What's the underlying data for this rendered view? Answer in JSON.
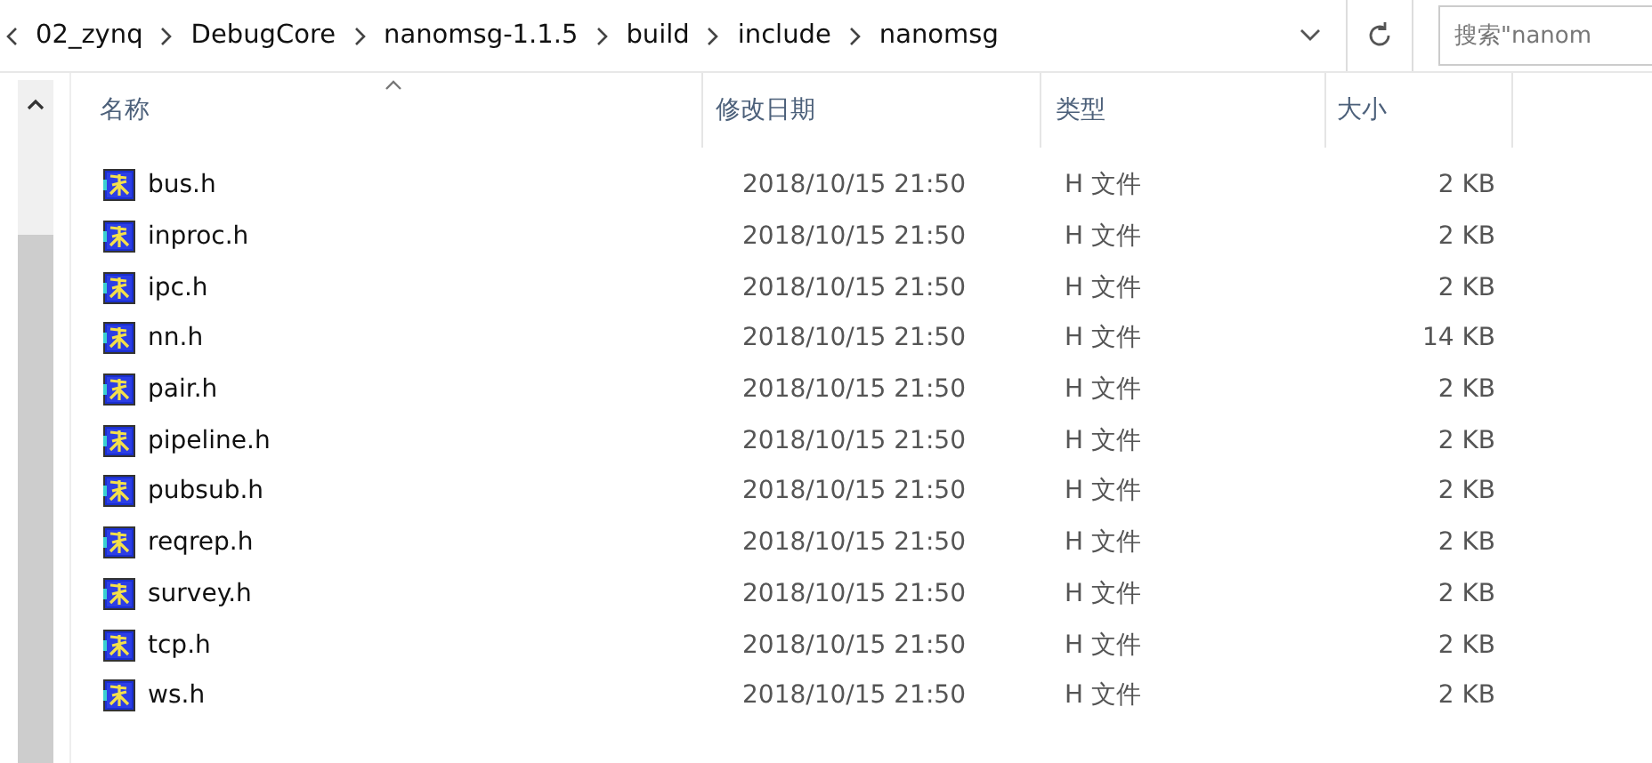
{
  "address_bar": {
    "path": [
      "02_zynq",
      "DebugCore",
      "nanomsg-1.1.5",
      "build",
      "include",
      "nanomsg"
    ]
  },
  "search": {
    "placeholder": "搜索\"nanom"
  },
  "table": {
    "columns": [
      "名称",
      "修改日期",
      "类型",
      "大小"
    ],
    "rows": [
      {
        "name": "bus.h",
        "modified": "2018/10/15 21:50",
        "type": "H 文件",
        "size": "2 KB"
      },
      {
        "name": "inproc.h",
        "modified": "2018/10/15 21:50",
        "type": "H 文件",
        "size": "2 KB"
      },
      {
        "name": "ipc.h",
        "modified": "2018/10/15 21:50",
        "type": "H 文件",
        "size": "2 KB"
      },
      {
        "name": "nn.h",
        "modified": "2018/10/15 21:50",
        "type": "H 文件",
        "size": "14 KB"
      },
      {
        "name": "pair.h",
        "modified": "2018/10/15 21:50",
        "type": "H 文件",
        "size": "2 KB"
      },
      {
        "name": "pipeline.h",
        "modified": "2018/10/15 21:50",
        "type": "H 文件",
        "size": "2 KB"
      },
      {
        "name": "pubsub.h",
        "modified": "2018/10/15 21:50",
        "type": "H 文件",
        "size": "2 KB"
      },
      {
        "name": "reqrep.h",
        "modified": "2018/10/15 21:50",
        "type": "H 文件",
        "size": "2 KB"
      },
      {
        "name": "survey.h",
        "modified": "2018/10/15 21:50",
        "type": "H 文件",
        "size": "2 KB"
      },
      {
        "name": "tcp.h",
        "modified": "2018/10/15 21:50",
        "type": "H 文件",
        "size": "2 KB"
      },
      {
        "name": "ws.h",
        "modified": "2018/10/15 21:50",
        "type": "H 文件",
        "size": "2 KB"
      }
    ]
  }
}
